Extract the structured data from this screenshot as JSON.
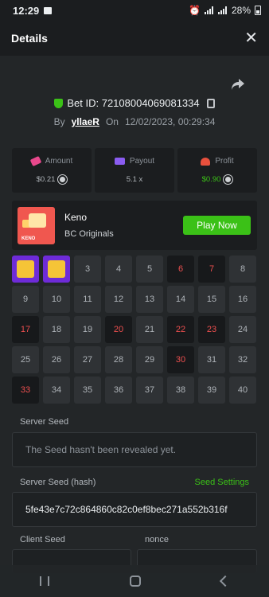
{
  "statusbar": {
    "time": "12:29",
    "battery": "28%"
  },
  "header": {
    "title": "Details",
    "close_icon": "close-icon"
  },
  "bet": {
    "id_text": "Bet ID: 72108004069081334",
    "by_label": "By",
    "user": "yllaeR",
    "on_label": "On",
    "datetime": "12/02/2023, 00:29:34"
  },
  "stats": {
    "amount": {
      "label": "Amount",
      "value": "$0.21"
    },
    "payout": {
      "label": "Payout",
      "value": "5.1 x"
    },
    "profit": {
      "label": "Profit",
      "value": "$0.90",
      "color": "#3bc117"
    }
  },
  "game": {
    "thumb_text": "KENO",
    "name": "Keno",
    "provider": "BC Originals",
    "play_label": "Play Now"
  },
  "keno": {
    "numbers": [
      "1",
      "2",
      "3",
      "4",
      "5",
      "6",
      "7",
      "8",
      "9",
      "10",
      "11",
      "12",
      "13",
      "14",
      "15",
      "16",
      "17",
      "18",
      "19",
      "20",
      "21",
      "22",
      "23",
      "24",
      "25",
      "26",
      "27",
      "28",
      "29",
      "30",
      "31",
      "32",
      "33",
      "34",
      "35",
      "36",
      "37",
      "38",
      "39",
      "40"
    ],
    "hits": [
      1,
      2
    ],
    "drawn": [
      6,
      7,
      17,
      20,
      22,
      23,
      30,
      33
    ],
    "colors": {
      "hit": "#6e2bd8",
      "drawn_text": "#ed4f4f"
    }
  },
  "seeds": {
    "server_label": "Server Seed",
    "server_value": "The Seed hasn't been revealed yet.",
    "hash_label": "Server Seed (hash)",
    "settings_link": "Seed Settings",
    "hash_value": "5fe43e7c72c864860c82c0ef8bec271a552b316f",
    "client_label": "Client Seed",
    "nonce_label": "nonce"
  }
}
